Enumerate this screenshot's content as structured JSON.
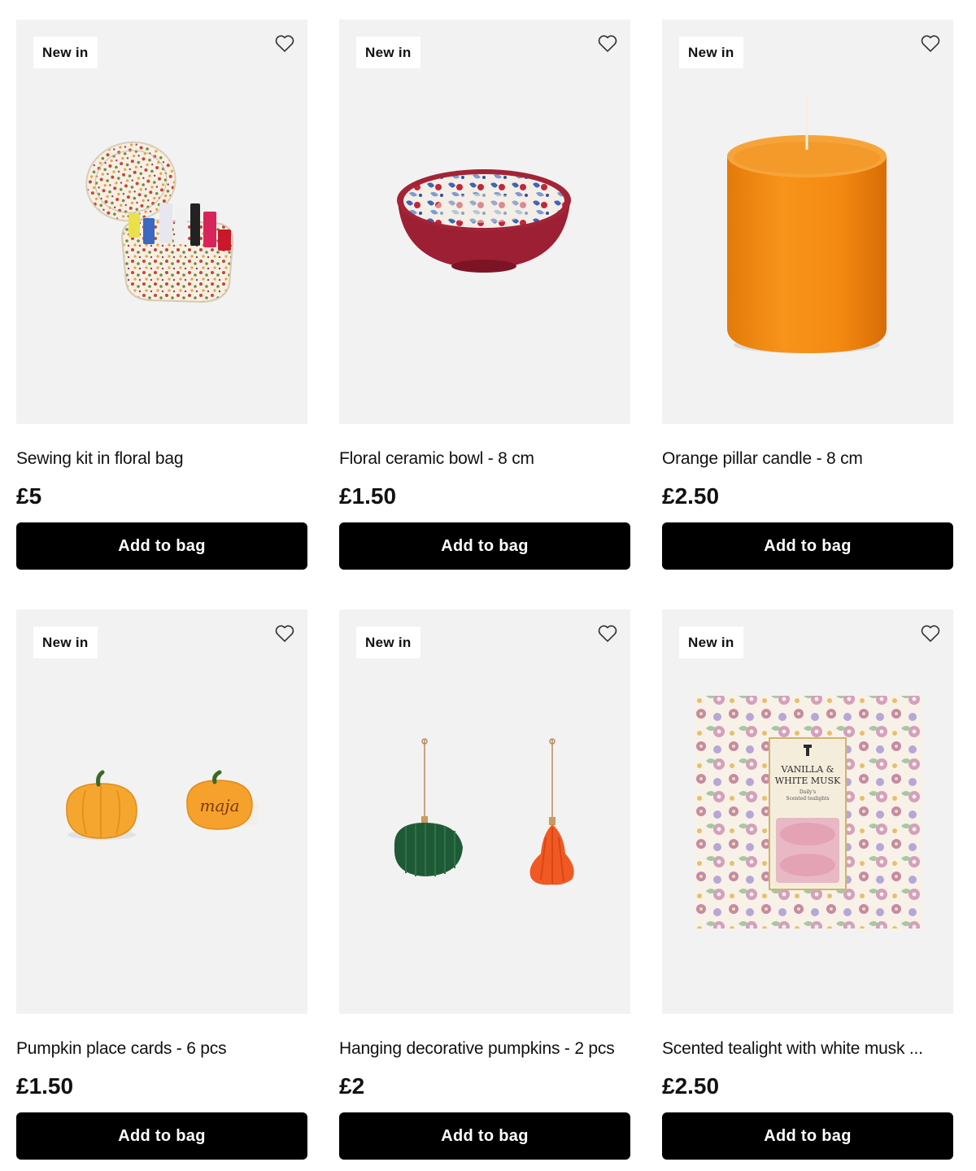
{
  "products": [
    {
      "badge": "New in",
      "name": "Sewing kit in floral bag",
      "price": "£5",
      "cta": "Add to bag",
      "favorite_icon": "heart-outline-icon",
      "image": "sewing-kit-image"
    },
    {
      "badge": "New in",
      "name": "Floral ceramic bowl - 8 cm",
      "price": "£1.50",
      "cta": "Add to bag",
      "favorite_icon": "heart-outline-icon",
      "image": "ceramic-bowl-image"
    },
    {
      "badge": "New in",
      "name": "Orange pillar candle - 8 cm",
      "price": "£2.50",
      "cta": "Add to bag",
      "favorite_icon": "heart-outline-icon",
      "image": "pillar-candle-image"
    },
    {
      "badge": "New in",
      "name": "Pumpkin place cards - 6 pcs",
      "price": "£1.50",
      "cta": "Add to bag",
      "favorite_icon": "heart-outline-icon",
      "image": "pumpkin-place-cards-image"
    },
    {
      "badge": "New in",
      "name": "Hanging decorative pumpkins - 2 pcs",
      "price": "£2",
      "cta": "Add to bag",
      "favorite_icon": "heart-outline-icon",
      "image": "hanging-pumpkins-image"
    },
    {
      "badge": "New in",
      "name": "Scented tealight with white musk ...",
      "price": "£2.50",
      "cta": "Add to bag",
      "favorite_icon": "heart-outline-icon",
      "image": "scented-tealight-image",
      "package_text": {
        "line1": "VANILLA &",
        "line2": "WHITE MUSK",
        "line3": "Daily's",
        "line4": "Scented tealights"
      }
    }
  ],
  "colors": {
    "card_bg": "#f2f2f2",
    "button_bg": "#000000",
    "button_text": "#ffffff",
    "text": "#111111"
  }
}
